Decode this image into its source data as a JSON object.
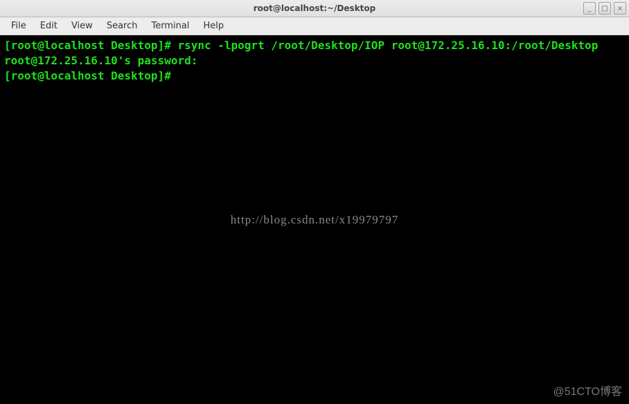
{
  "window": {
    "title": "root@localhost:~/Desktop"
  },
  "controls": {
    "minimize": "_",
    "maximize": "□",
    "close": "×"
  },
  "menu": {
    "file": "File",
    "edit": "Edit",
    "view": "View",
    "search": "Search",
    "terminal": "Terminal",
    "help": "Help"
  },
  "term": {
    "line1": "[root@localhost Desktop]# rsync -lpogrt /root/Desktop/IOP root@172.25.16.10:/root/Desktop",
    "line2": "root@172.25.16.10's password:",
    "line3": "[root@localhost Desktop]# "
  },
  "watermark": {
    "center": "http://blog.csdn.net/x19979797",
    "corner": "@51CTO博客"
  }
}
